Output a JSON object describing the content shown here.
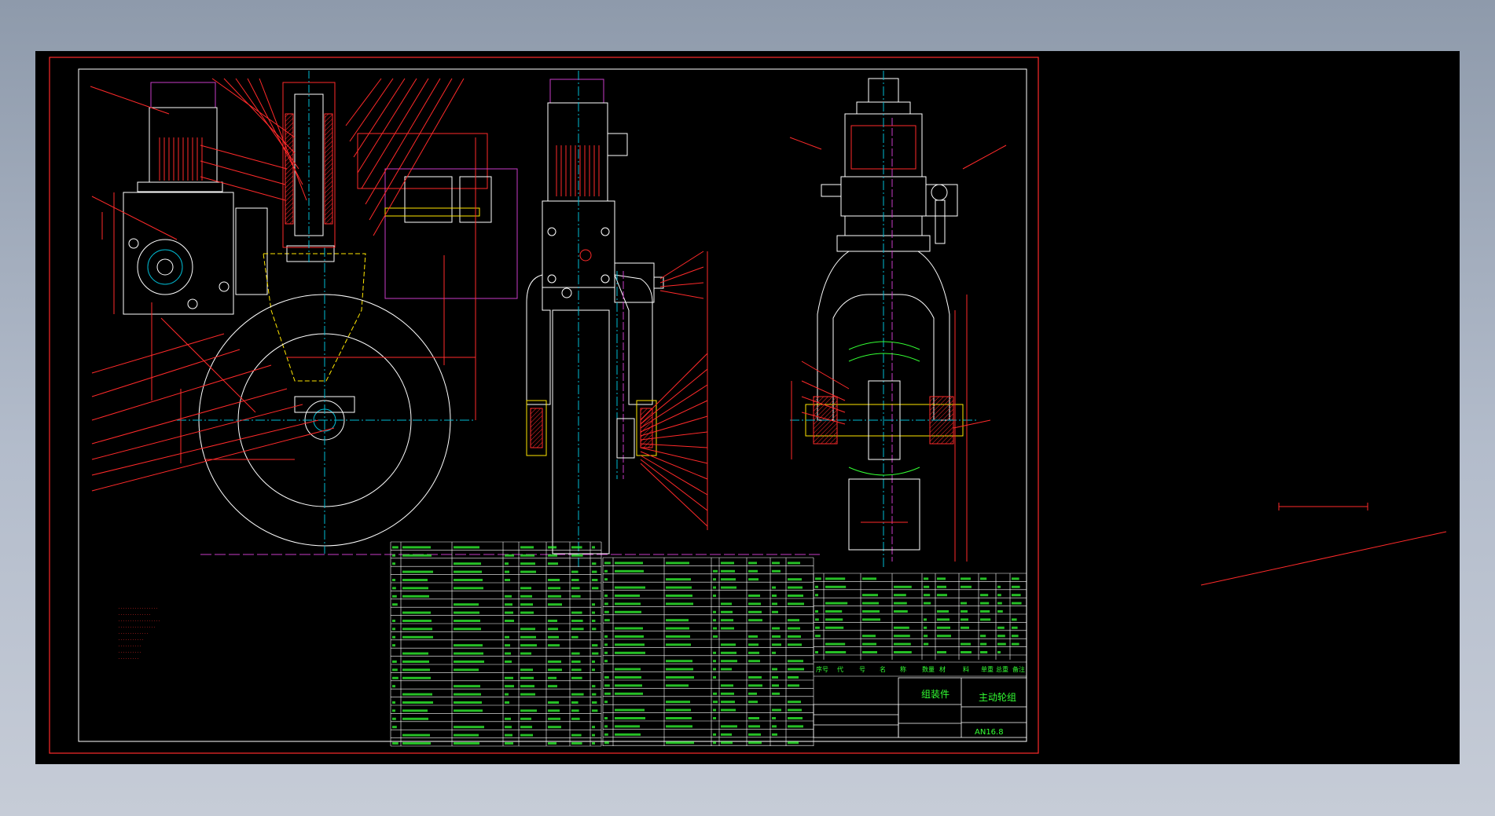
{
  "colors": {
    "background": "#8e9aab",
    "model_space": "#000000",
    "frame": "#ff2a2a",
    "white_line": "#ffffff",
    "green_text": "#33ff33",
    "magenta": "#c83cc8",
    "cyan": "#00bcd4",
    "yellow": "#ffe600"
  },
  "title_block": {
    "assembly": "组装件",
    "drawing_name": "主动轮组",
    "drawing_no": "AN16.8"
  },
  "bom_headers": [
    "序号",
    "代",
    "号",
    "名",
    "称",
    "数量",
    "材",
    "料",
    "单重",
    "总重",
    "备注"
  ]
}
